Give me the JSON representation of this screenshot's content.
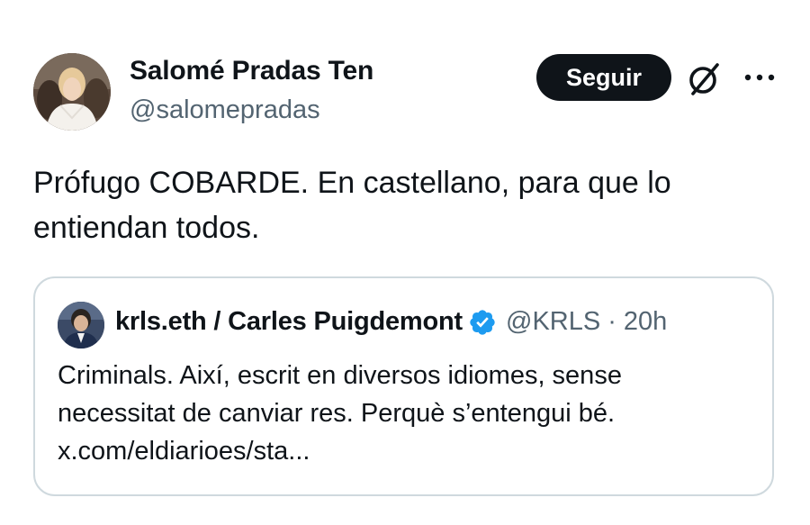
{
  "tweet": {
    "author_name": "Salomé Pradas Ten",
    "author_handle": "@salomepradas",
    "follow_label": "Seguir",
    "body": "Prófugo COBARDE. En castellano, para que lo entiendan todos.",
    "icons": {
      "grok": "grok-icon",
      "more": "more-icon"
    }
  },
  "quoted": {
    "author_name": "krls.eth / Carles Puigdemont",
    "verified": true,
    "author_handle": "@KRLS",
    "separator": "·",
    "time": "20h",
    "lines": [
      "Criminals. Així, escrit en diversos idiomes, sense",
      "necessitat de canviar res. Perquè s’entengui bé.",
      "x.com/eldiarioes/sta..."
    ]
  },
  "colors": {
    "text": "#0f1419",
    "secondary": "#536471",
    "border": "#cfd9de",
    "verified": "#1d9bf0",
    "button_bg": "#0f1419"
  }
}
